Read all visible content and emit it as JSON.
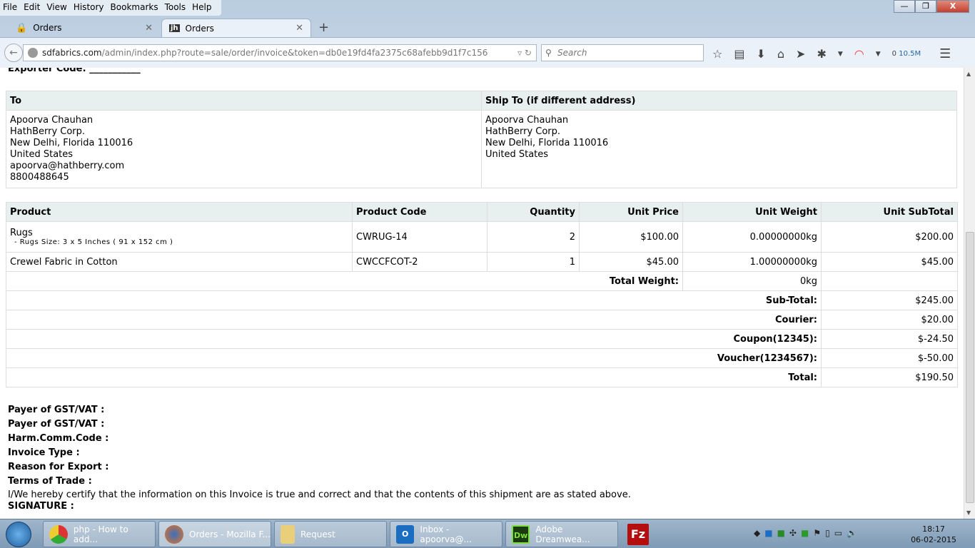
{
  "browser": {
    "menu": [
      "File",
      "Edit",
      "View",
      "History",
      "Bookmarks",
      "Tools",
      "Help"
    ],
    "tabs": [
      {
        "label": "Orders",
        "active": false
      },
      {
        "label": "Orders",
        "active": true
      }
    ],
    "url_host": "sdfabrics.com",
    "url_path": "/admin/index.php?route=sale/order/invoice&token=db0e19fd4fa2375c68afebb9d1f7c156",
    "search_placeholder": "Search",
    "counter": "0",
    "memory": "10.5M"
  },
  "invoice": {
    "exporter_code_label": "Exporter Code: ___________",
    "to_header": "To",
    "ship_header": "Ship To (if different address)",
    "to_lines": [
      "Apoorva Chauhan",
      "HathBerry Corp.",
      "New Delhi, Florida 110016",
      "United States",
      "apoorva@hathberry.com",
      "8800488645"
    ],
    "ship_lines": [
      "Apoorva Chauhan",
      "HathBerry Corp.",
      "New Delhi, Florida 110016",
      "United States"
    ],
    "columns": [
      "Product",
      "Product Code",
      "Quantity",
      "Unit Price",
      "Unit Weight",
      "Unit SubTotal"
    ],
    "items": [
      {
        "product": "Rugs",
        "option": "- Rugs Size: 3 x 5 Inches ( 91 x 152 cm )",
        "code": "CWRUG-14",
        "qty": "2",
        "price": "$100.00",
        "weight": "0.00000000kg",
        "subtotal": "$200.00"
      },
      {
        "product": "Crewel Fabric in Cotton",
        "option": "",
        "code": "CWCCFCOT-2",
        "qty": "1",
        "price": "$45.00",
        "weight": "1.00000000kg",
        "subtotal": "$45.00"
      }
    ],
    "total_weight_label": "Total Weight:",
    "total_weight": "0kg",
    "totals": [
      {
        "label": "Sub-Total:",
        "value": "$245.00"
      },
      {
        "label": "Courier:",
        "value": "$20.00"
      },
      {
        "label": "Coupon(12345):",
        "value": "$-24.50"
      },
      {
        "label": "Voucher(1234567):",
        "value": "$-50.00"
      },
      {
        "label": "Total:",
        "value": "$190.50"
      }
    ],
    "footer_labels": [
      "Payer of GST/VAT :",
      "Payer of GST/VAT :",
      "Harm.Comm.Code :",
      "Invoice Type :",
      "Reason for Export :",
      "Terms of Trade :"
    ],
    "certify": "I/We hereby certify that the information on this Invoice is true and correct and that the contents of this shipment are as stated above.",
    "signature": "SIGNATURE :"
  },
  "taskbar": {
    "items": [
      "php - How to add...",
      "Orders - Mozilla F...",
      "Request",
      "Inbox - apoorva@...",
      "Adobe Dreamwea..."
    ],
    "time": "18:17",
    "date": "06-02-2015"
  }
}
